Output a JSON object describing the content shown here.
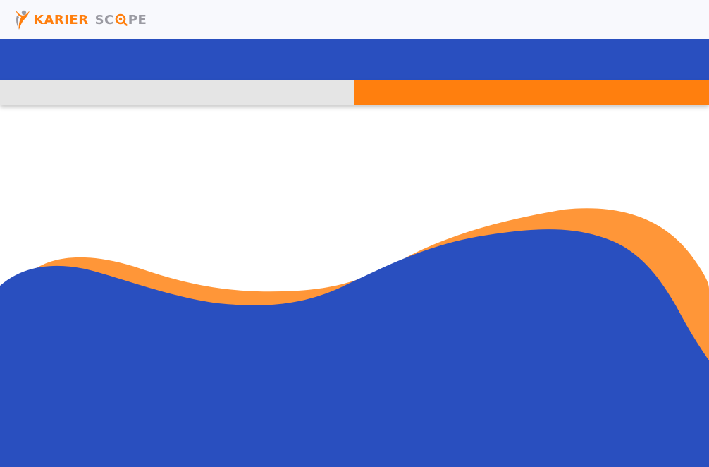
{
  "header": {
    "logo": {
      "word1": "KARIER",
      "word2_start": "SC",
      "word2_end": "PE"
    }
  },
  "tabs": [
    {
      "label": ""
    },
    {
      "label": ""
    }
  ],
  "colors": {
    "brand_blue": "#294fbf",
    "brand_orange": "#ff7f0e",
    "wave_orange": "#ff9638",
    "logo_gray": "#9a9aa2",
    "tab_inactive": "#e5e5e5"
  },
  "icons": {
    "logo_mark": "person-rocket-logo-icon",
    "logo_o": "target-magnifier-icon"
  }
}
